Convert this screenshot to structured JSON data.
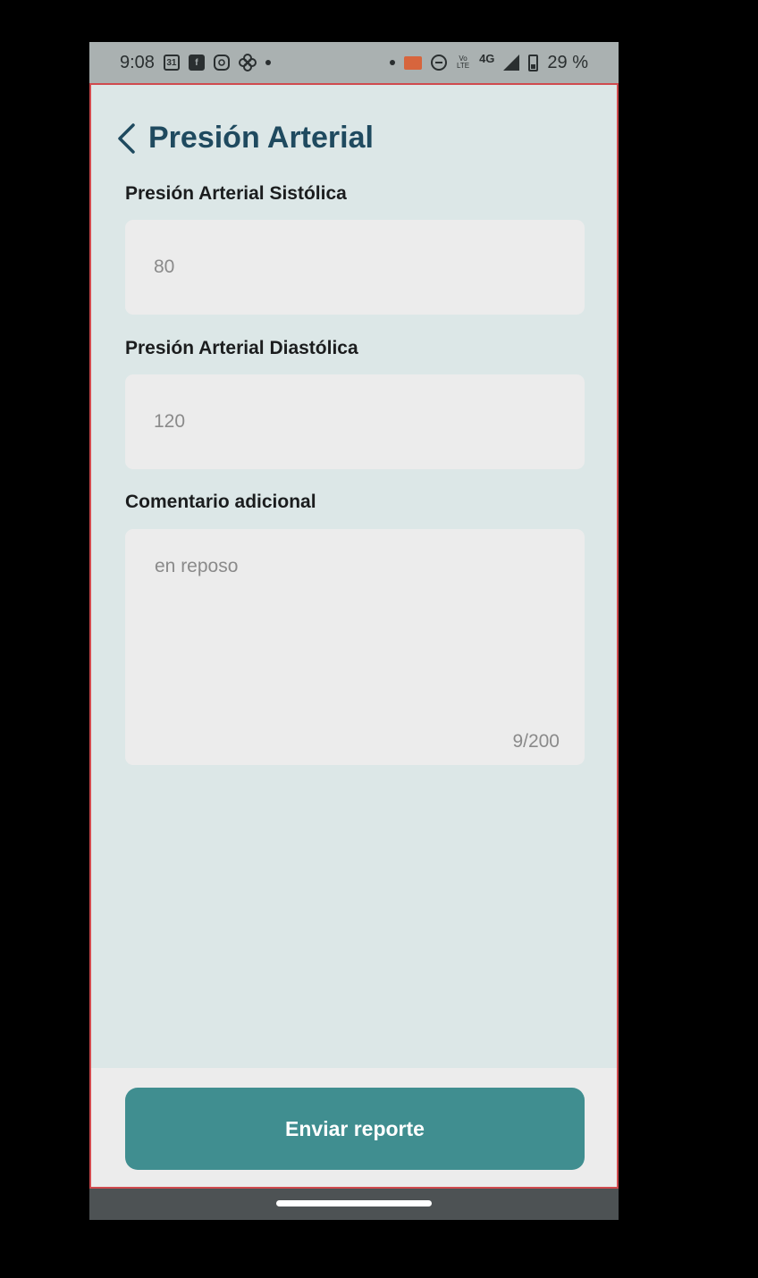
{
  "status_bar": {
    "time": "9:08",
    "calendar_label": "31",
    "facebook_label": "f",
    "network_label": "4G",
    "volte_label": "Vo LTE",
    "battery_percent": "29 %"
  },
  "header": {
    "title": "Presión Arterial"
  },
  "form": {
    "systolic_label": "Presión Arterial Sistólica",
    "systolic_value": "80",
    "diastolic_label": "Presión Arterial Diastólica",
    "diastolic_value": "120",
    "comment_label": "Comentario adicional",
    "comment_value": "en reposo",
    "comment_counter": "9/200"
  },
  "footer": {
    "submit_label": "Enviar reporte"
  },
  "colors": {
    "background": "#dce7e7",
    "title": "#1f4a5f",
    "button": "#408e90",
    "field": "#ececec",
    "frame_border": "#d04a4e"
  }
}
